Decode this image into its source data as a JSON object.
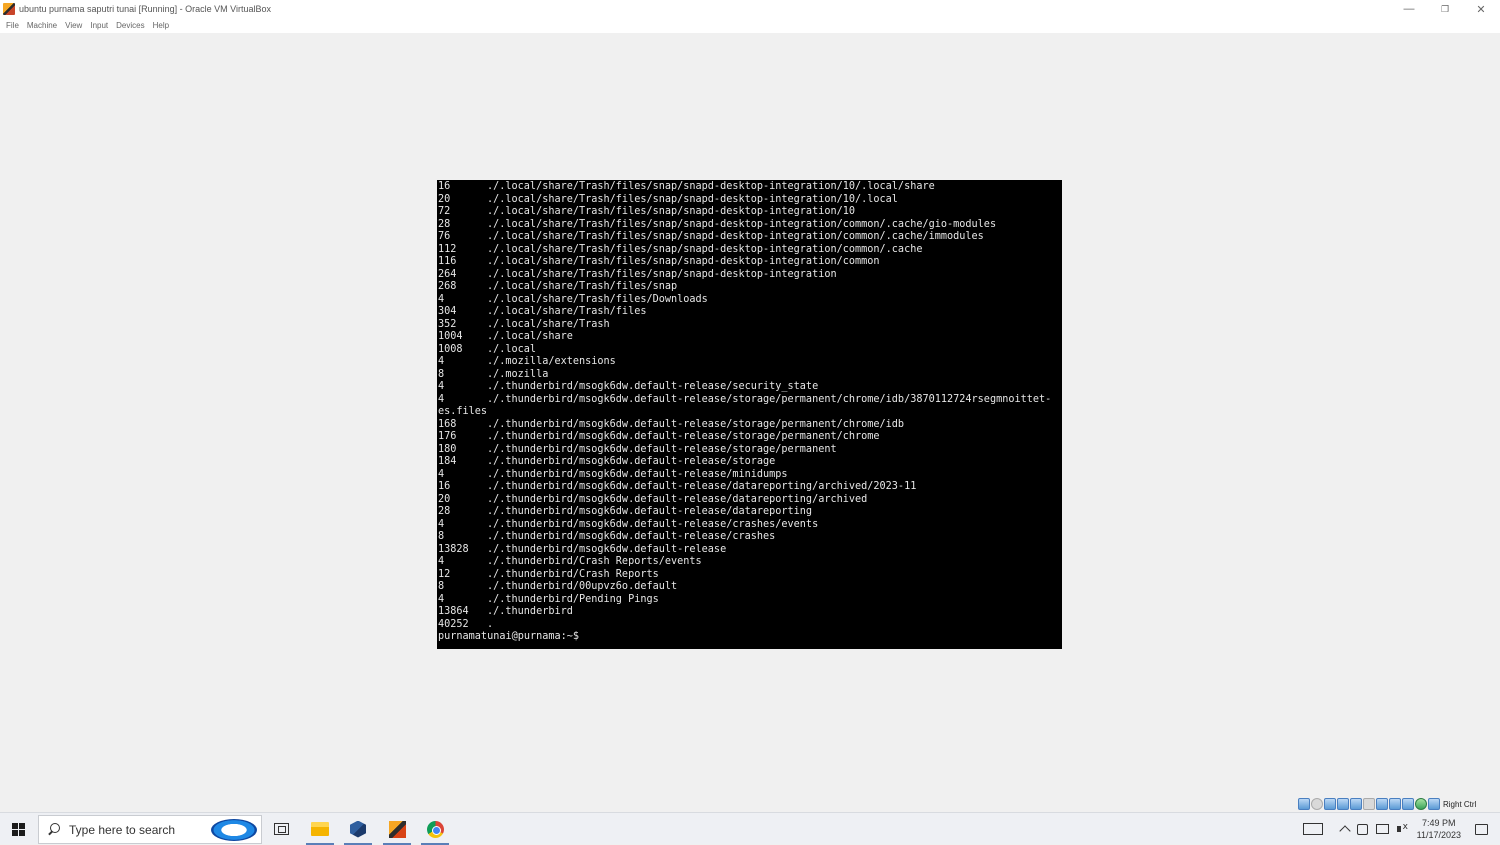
{
  "window": {
    "title": "ubuntu purnama saputri tunai [Running] - Oracle VM VirtualBox",
    "minimize_glyph": "—",
    "restore_glyph": "❐",
    "close_glyph": "✕"
  },
  "menu": [
    "File",
    "Machine",
    "View",
    "Input",
    "Devices",
    "Help"
  ],
  "terminal": {
    "lines": [
      {
        "size": "16",
        "path": "./.local/share/Trash/files/snap/snapd-desktop-integration/10/.local/share"
      },
      {
        "size": "20",
        "path": "./.local/share/Trash/files/snap/snapd-desktop-integration/10/.local"
      },
      {
        "size": "72",
        "path": "./.local/share/Trash/files/snap/snapd-desktop-integration/10"
      },
      {
        "size": "28",
        "path": "./.local/share/Trash/files/snap/snapd-desktop-integration/common/.cache/gio-modules"
      },
      {
        "size": "76",
        "path": "./.local/share/Trash/files/snap/snapd-desktop-integration/common/.cache/immodules"
      },
      {
        "size": "112",
        "path": "./.local/share/Trash/files/snap/snapd-desktop-integration/common/.cache"
      },
      {
        "size": "116",
        "path": "./.local/share/Trash/files/snap/snapd-desktop-integration/common"
      },
      {
        "size": "264",
        "path": "./.local/share/Trash/files/snap/snapd-desktop-integration"
      },
      {
        "size": "268",
        "path": "./.local/share/Trash/files/snap"
      },
      {
        "size": "4",
        "path": "./.local/share/Trash/files/Downloads"
      },
      {
        "size": "304",
        "path": "./.local/share/Trash/files"
      },
      {
        "size": "352",
        "path": "./.local/share/Trash"
      },
      {
        "size": "1004",
        "path": "./.local/share"
      },
      {
        "size": "1008",
        "path": "./.local"
      },
      {
        "size": "4",
        "path": "./.mozilla/extensions"
      },
      {
        "size": "8",
        "path": "./.mozilla"
      },
      {
        "size": "4",
        "path": "./.thunderbird/msogk6dw.default-release/security_state"
      },
      {
        "size": "4",
        "path": "./.thunderbird/msogk6dw.default-release/storage/permanent/chrome/idb/3870112724rsegmnoittet-"
      },
      {
        "size": "",
        "path": "es.files",
        "cont": true
      },
      {
        "size": "168",
        "path": "./.thunderbird/msogk6dw.default-release/storage/permanent/chrome/idb"
      },
      {
        "size": "176",
        "path": "./.thunderbird/msogk6dw.default-release/storage/permanent/chrome"
      },
      {
        "size": "180",
        "path": "./.thunderbird/msogk6dw.default-release/storage/permanent"
      },
      {
        "size": "184",
        "path": "./.thunderbird/msogk6dw.default-release/storage"
      },
      {
        "size": "4",
        "path": "./.thunderbird/msogk6dw.default-release/minidumps"
      },
      {
        "size": "16",
        "path": "./.thunderbird/msogk6dw.default-release/datareporting/archived/2023-11"
      },
      {
        "size": "20",
        "path": "./.thunderbird/msogk6dw.default-release/datareporting/archived"
      },
      {
        "size": "28",
        "path": "./.thunderbird/msogk6dw.default-release/datareporting"
      },
      {
        "size": "4",
        "path": "./.thunderbird/msogk6dw.default-release/crashes/events"
      },
      {
        "size": "8",
        "path": "./.thunderbird/msogk6dw.default-release/crashes"
      },
      {
        "size": "13828",
        "path": "./.thunderbird/msogk6dw.default-release"
      },
      {
        "size": "4",
        "path": "./.thunderbird/Crash Reports/events"
      },
      {
        "size": "12",
        "path": "./.thunderbird/Crash Reports"
      },
      {
        "size": "8",
        "path": "./.thunderbird/00upvz6o.default"
      },
      {
        "size": "4",
        "path": "./.thunderbird/Pending Pings"
      },
      {
        "size": "13864",
        "path": "./.thunderbird"
      },
      {
        "size": "40252",
        "path": "."
      }
    ],
    "prompt": "purnamatunai@purnama:~$"
  },
  "status_bar": {
    "icons": [
      "hard-disk-icon",
      "optical-drive-icon",
      "audio-icon",
      "network-icon",
      "usb-icon",
      "shared-folder-icon",
      "display-icon",
      "recording-icon",
      "cpu-icon",
      "green-status-icon",
      "keyboard-capture-icon",
      "mouse-integration-icon"
    ],
    "host_key": "Right Ctrl"
  },
  "taskbar": {
    "search_placeholder": "Type here to search",
    "time": "7:49 PM",
    "date": "11/17/2023"
  }
}
